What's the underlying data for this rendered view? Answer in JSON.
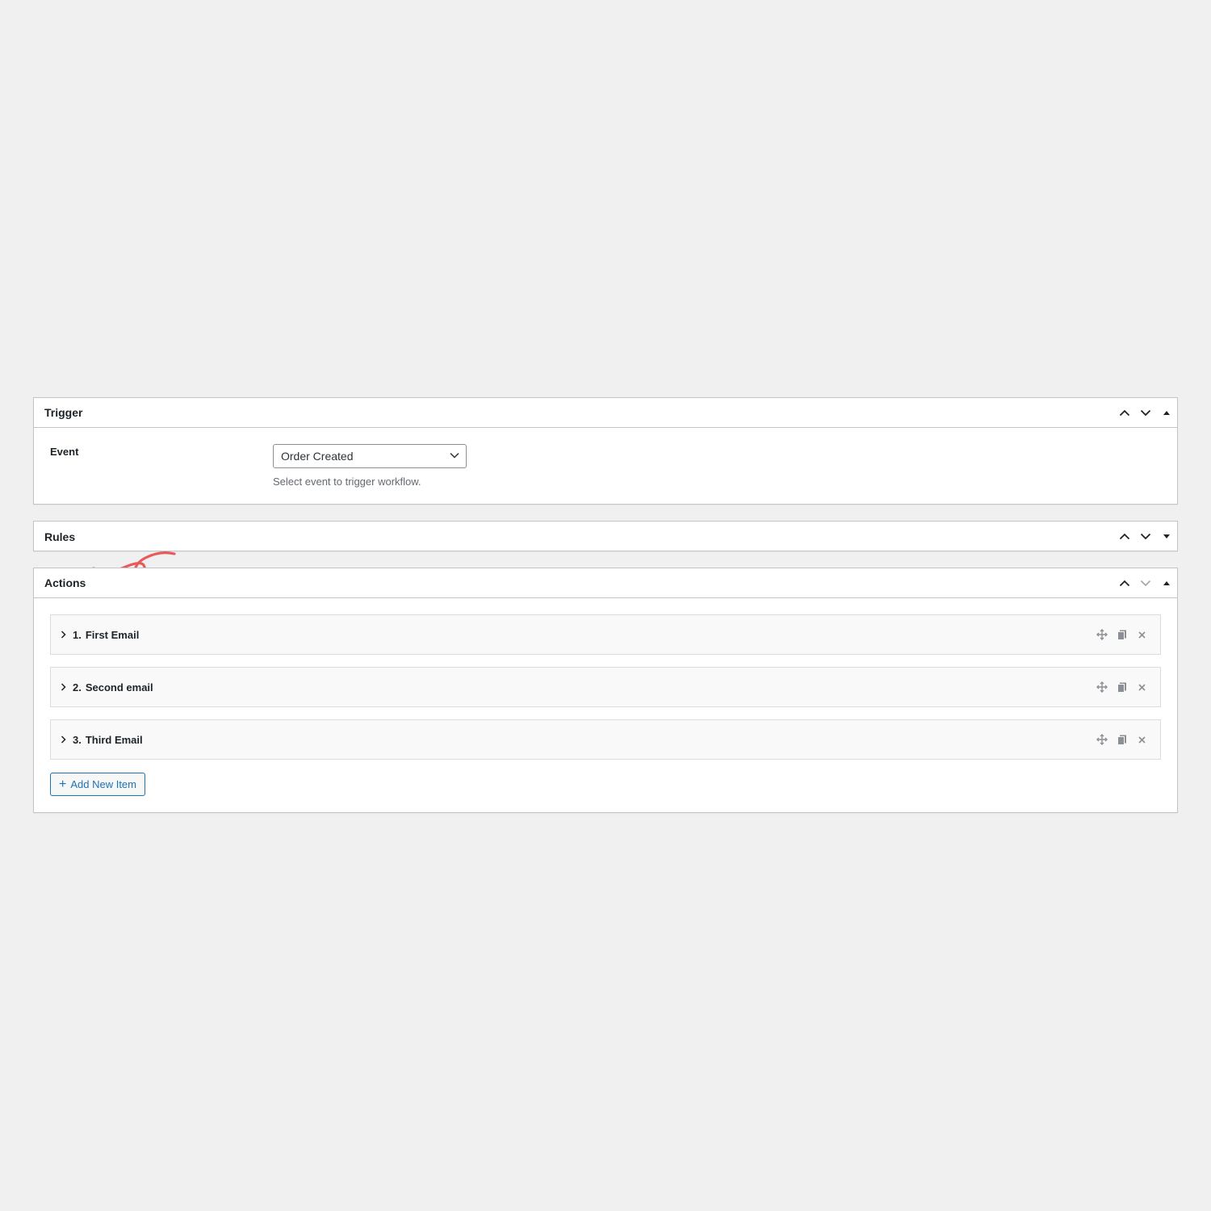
{
  "trigger": {
    "title": "Trigger",
    "field_label": "Event",
    "select_value": "Order Created",
    "description": "Select event to trigger workflow."
  },
  "rules": {
    "title": "Rules"
  },
  "actions": {
    "title": "Actions",
    "items": [
      {
        "number": "1.",
        "title": "First Email"
      },
      {
        "number": "2.",
        "title": "Second email"
      },
      {
        "number": "3.",
        "title": "Third Email"
      }
    ],
    "add_button_label": "Add New Item",
    "add_button_icon": "+"
  },
  "colors": {
    "background": "#f0f0f1",
    "panel_border": "#c3c4c7",
    "accent": "#2271b1",
    "annotation_arrow": "#e85a5a",
    "muted_text": "#646970"
  },
  "icons": {
    "move_up": "chevron-up-icon",
    "move_down": "chevron-down-icon",
    "toggle_open": "triangle-up-icon",
    "toggle_closed": "triangle-down-icon",
    "drag": "move-icon",
    "duplicate": "copy-icon",
    "remove": "close-icon",
    "expand": "chevron-right-icon"
  }
}
